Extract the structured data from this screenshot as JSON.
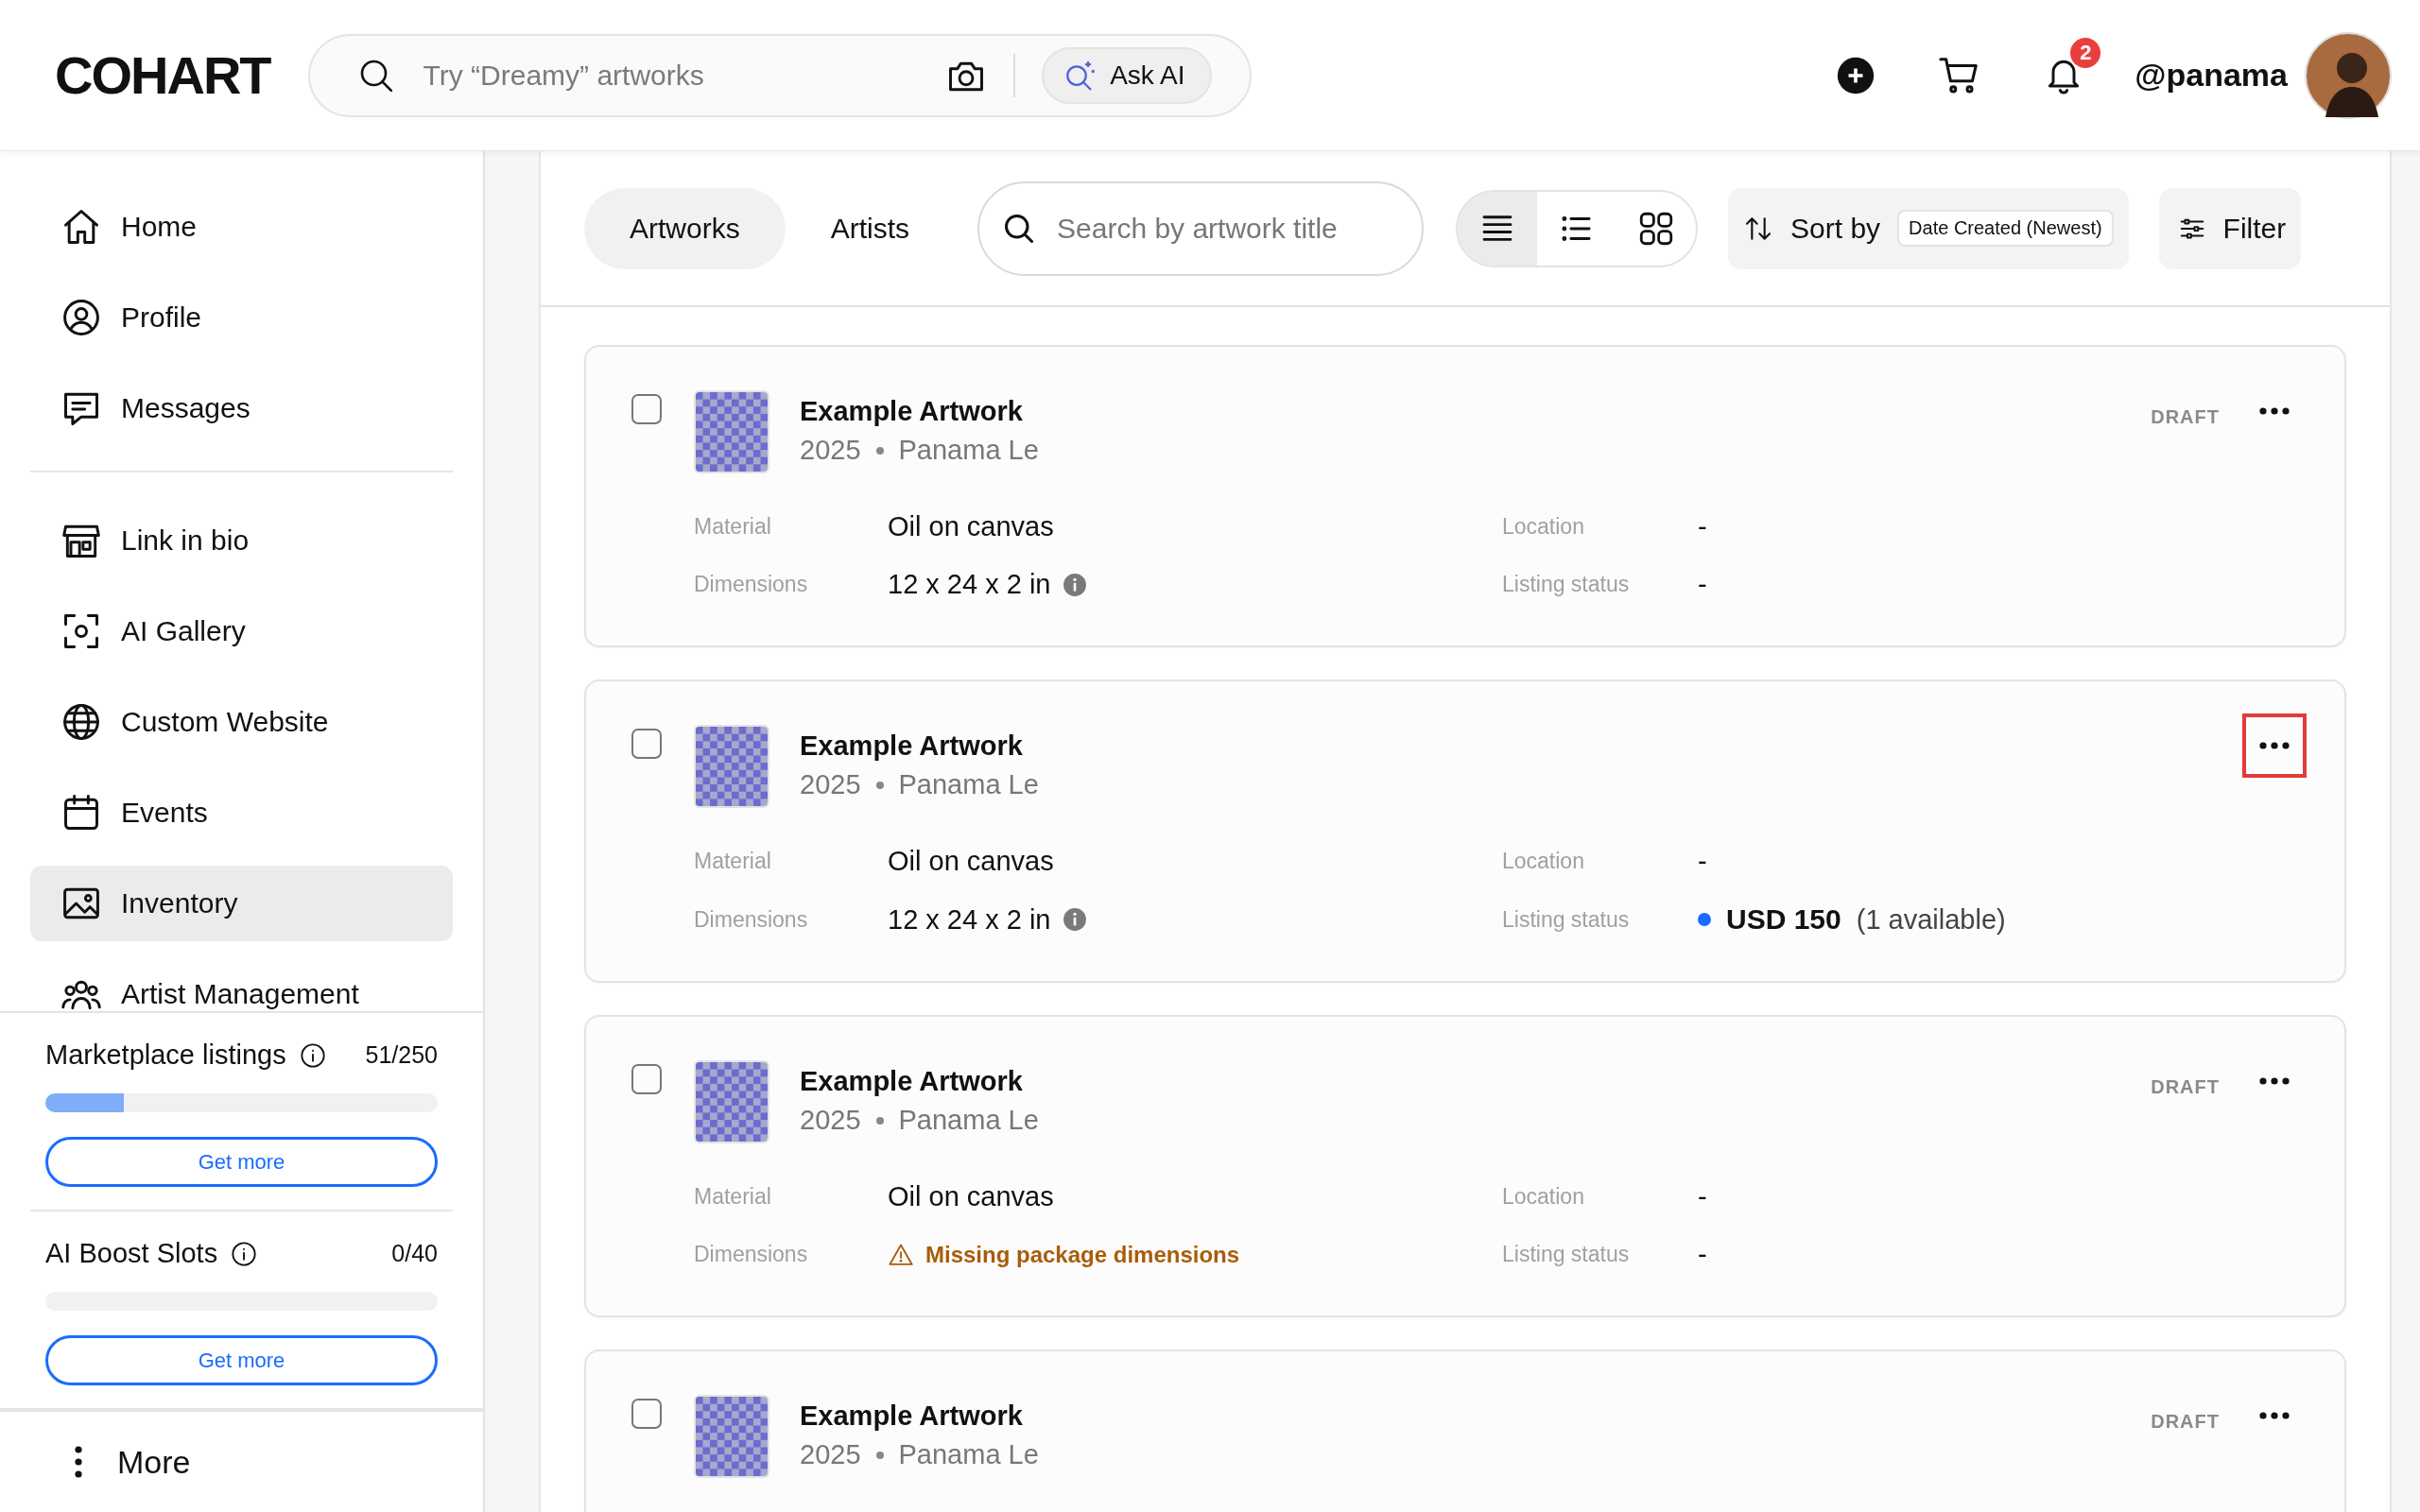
{
  "header": {
    "logo": "COHART",
    "search": {
      "placeholder": "Try “Dreamy” artworks"
    },
    "ask_ai": "Ask AI",
    "notification_count": "2",
    "username": "@panama"
  },
  "sidebar": {
    "nav_groups": [
      [
        {
          "label": "Home",
          "selected": false
        },
        {
          "label": "Profile",
          "selected": false
        },
        {
          "label": "Messages",
          "selected": false
        }
      ],
      [
        {
          "label": "Link in bio",
          "selected": false
        },
        {
          "label": "AI Gallery",
          "selected": false
        },
        {
          "label": "Custom Website",
          "selected": false
        },
        {
          "label": "Events",
          "selected": false
        },
        {
          "label": "Inventory",
          "selected": true
        },
        {
          "label": "Artist Management",
          "selected": false
        }
      ]
    ],
    "quotas": [
      {
        "label": "Marketplace listings",
        "count": "51/250",
        "level": 0.2,
        "button": "Get more"
      },
      {
        "label": "AI Boost Slots",
        "count": "0/40",
        "level": 0,
        "button": "Get more"
      }
    ],
    "more": "More"
  },
  "toolbar": {
    "tabs": [
      {
        "label": "Artworks",
        "selected": true
      },
      {
        "label": "Artists",
        "selected": false
      }
    ],
    "search": {
      "placeholder": "Search by artwork title"
    },
    "views": [
      {
        "kind": "rows",
        "selected": true
      },
      {
        "kind": "list",
        "selected": false
      },
      {
        "kind": "grid",
        "selected": false
      }
    ],
    "sort": {
      "label": "Sort by",
      "value": "Date Created (Newest)"
    },
    "filter": "Filter"
  },
  "artworks": [
    {
      "title": "Example Artwork",
      "year": "2025",
      "artist": "Panama Le",
      "status": "DRAFT",
      "checked": false,
      "menu_highlighted": false,
      "details": [
        {
          "label": "Material",
          "kind": "text",
          "value": "Oil on canvas"
        },
        {
          "label": "Location",
          "kind": "text",
          "value": "-"
        },
        {
          "label": "Dimensions",
          "kind": "info",
          "value": "12 x 24 x 2 in"
        },
        {
          "label": "Listing status",
          "kind": "text",
          "value": "-"
        }
      ]
    },
    {
      "title": "Example Artwork",
      "year": "2025",
      "artist": "Panama Le",
      "checked": false,
      "menu_highlighted": true,
      "details": [
        {
          "label": "Material",
          "kind": "text",
          "value": "Oil on canvas"
        },
        {
          "label": "Location",
          "kind": "text",
          "value": "-"
        },
        {
          "label": "Dimensions",
          "kind": "info",
          "value": "12 x 24 x 2 in"
        },
        {
          "label": "Listing status",
          "kind": "price",
          "value": "USD 150",
          "note": "(1 available)",
          "color": "#1a6cff"
        }
      ]
    },
    {
      "title": "Example Artwork",
      "year": "2025",
      "artist": "Panama Le",
      "status": "DRAFT",
      "checked": false,
      "menu_highlighted": false,
      "details": [
        {
          "label": "Material",
          "kind": "text",
          "value": "Oil on canvas"
        },
        {
          "label": "Location",
          "kind": "text",
          "value": "-"
        },
        {
          "label": "Dimensions",
          "kind": "warning",
          "value": "Missing package dimensions"
        },
        {
          "label": "Listing status",
          "kind": "text",
          "value": "-"
        }
      ]
    },
    {
      "title": "Example Artwork",
      "year": "2025",
      "artist": "Panama Le",
      "status": "DRAFT",
      "checked": false,
      "menu_highlighted": false
    }
  ]
}
